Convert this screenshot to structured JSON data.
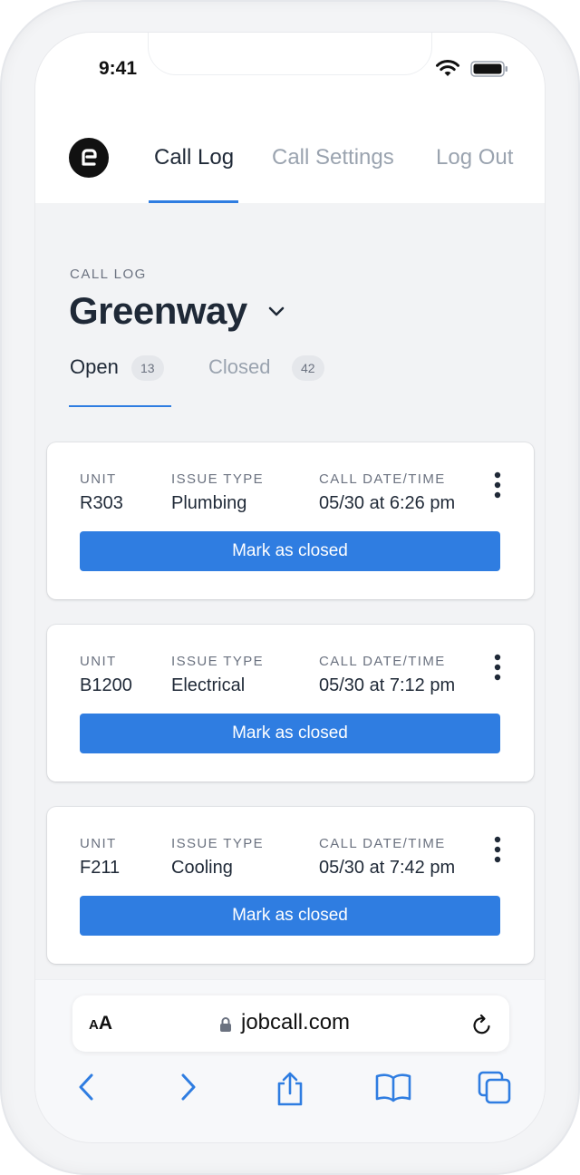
{
  "status": {
    "time": "9:41"
  },
  "nav": {
    "tabs": [
      {
        "label": "Call Log",
        "active": true
      },
      {
        "label": "Call Settings",
        "active": false
      },
      {
        "label": "Log Out",
        "active": false
      }
    ]
  },
  "header": {
    "eyebrow": "CALL LOG",
    "title": "Greenway"
  },
  "sub_tabs": [
    {
      "label": "Open",
      "count": "13",
      "active": true
    },
    {
      "label": "Closed",
      "count": "42",
      "active": false
    }
  ],
  "columns": {
    "unit": "UNIT",
    "issue_type": "ISSUE TYPE",
    "call_datetime": "CALL DATE/TIME"
  },
  "calls": [
    {
      "unit": "R303",
      "issue_type": "Plumbing",
      "call_datetime": "05/30 at 6:26 pm",
      "action_label": "Mark as closed"
    },
    {
      "unit": "B1200",
      "issue_type": "Electrical",
      "call_datetime": "05/30 at 7:12 pm",
      "action_label": "Mark as closed"
    },
    {
      "unit": "F211",
      "issue_type": "Cooling",
      "call_datetime": "05/30 at 7:42 pm",
      "action_label": "Mark as closed"
    }
  ],
  "browser": {
    "text_size_small": "A",
    "text_size_large": "A",
    "url": "jobcall.com"
  },
  "colors": {
    "accent": "#2f7de1",
    "text_primary": "#1f2937",
    "text_muted": "#9aa3af",
    "background": "#f2f3f5"
  }
}
